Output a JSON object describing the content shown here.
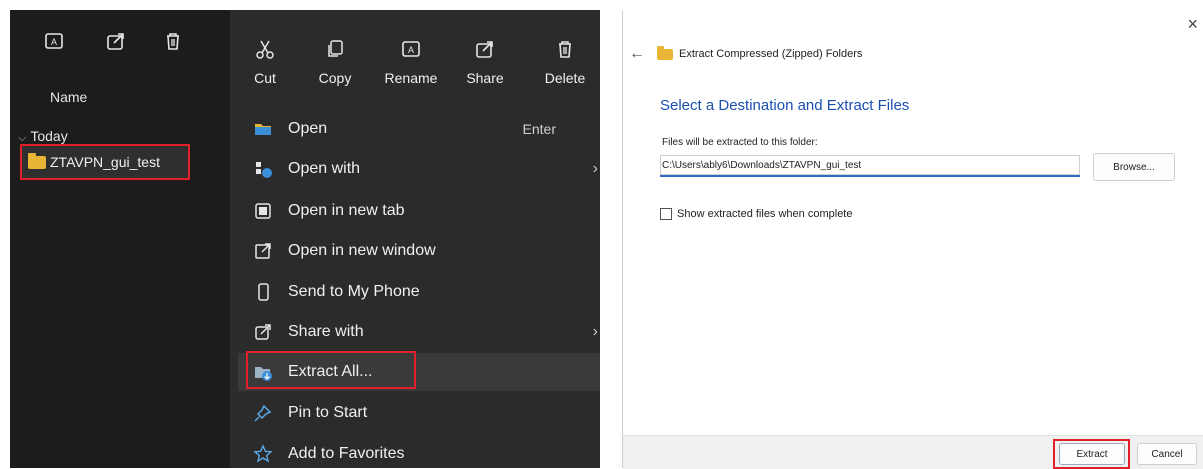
{
  "explorer": {
    "toolbar_icons": [
      "rename-icon",
      "share-icon",
      "delete-icon"
    ],
    "name_header": "Name",
    "group_label": "Today",
    "file_name": "ZTAVPN_gui_test"
  },
  "context_menu": {
    "actions": [
      {
        "label": "Cut",
        "icon": "scissors-icon"
      },
      {
        "label": "Copy",
        "icon": "copy-icon"
      },
      {
        "label": "Rename",
        "icon": "rename-icon"
      },
      {
        "label": "Share",
        "icon": "share-icon"
      },
      {
        "label": "Delete",
        "icon": "trash-icon"
      }
    ],
    "items": [
      {
        "label": "Open",
        "shortcut": "Enter",
        "icon": "folder-icon"
      },
      {
        "label": "Open with",
        "icon": "open-with-icon",
        "submenu": true
      },
      {
        "label": "Open in new tab",
        "icon": "new-tab-icon"
      },
      {
        "label": "Open in new window",
        "icon": "new-window-icon"
      },
      {
        "label": "Send to My Phone",
        "icon": "phone-icon"
      },
      {
        "label": "Share with",
        "icon": "share-icon",
        "submenu": true
      },
      {
        "label": "Extract All...",
        "icon": "extract-icon"
      },
      {
        "label": "Pin to Start",
        "icon": "pin-icon"
      },
      {
        "label": "Add to Favorites",
        "icon": "star-icon"
      }
    ]
  },
  "dialog": {
    "close": "×",
    "back": "←",
    "title": "Extract Compressed (Zipped) Folders",
    "heading": "Select a Destination and Extract Files",
    "dest_label": "Files will be extracted to this folder:",
    "dest_value": "C:\\Users\\ably6\\Downloads\\ZTAVPN_gui_test",
    "browse_label": "Browse...",
    "show_files_label": "Show extracted files when complete",
    "extract_label": "Extract",
    "cancel_label": "Cancel"
  },
  "colors": {
    "highlight": "#e0202a",
    "accent": "#1a4fb0",
    "folder": "#e8b536"
  }
}
